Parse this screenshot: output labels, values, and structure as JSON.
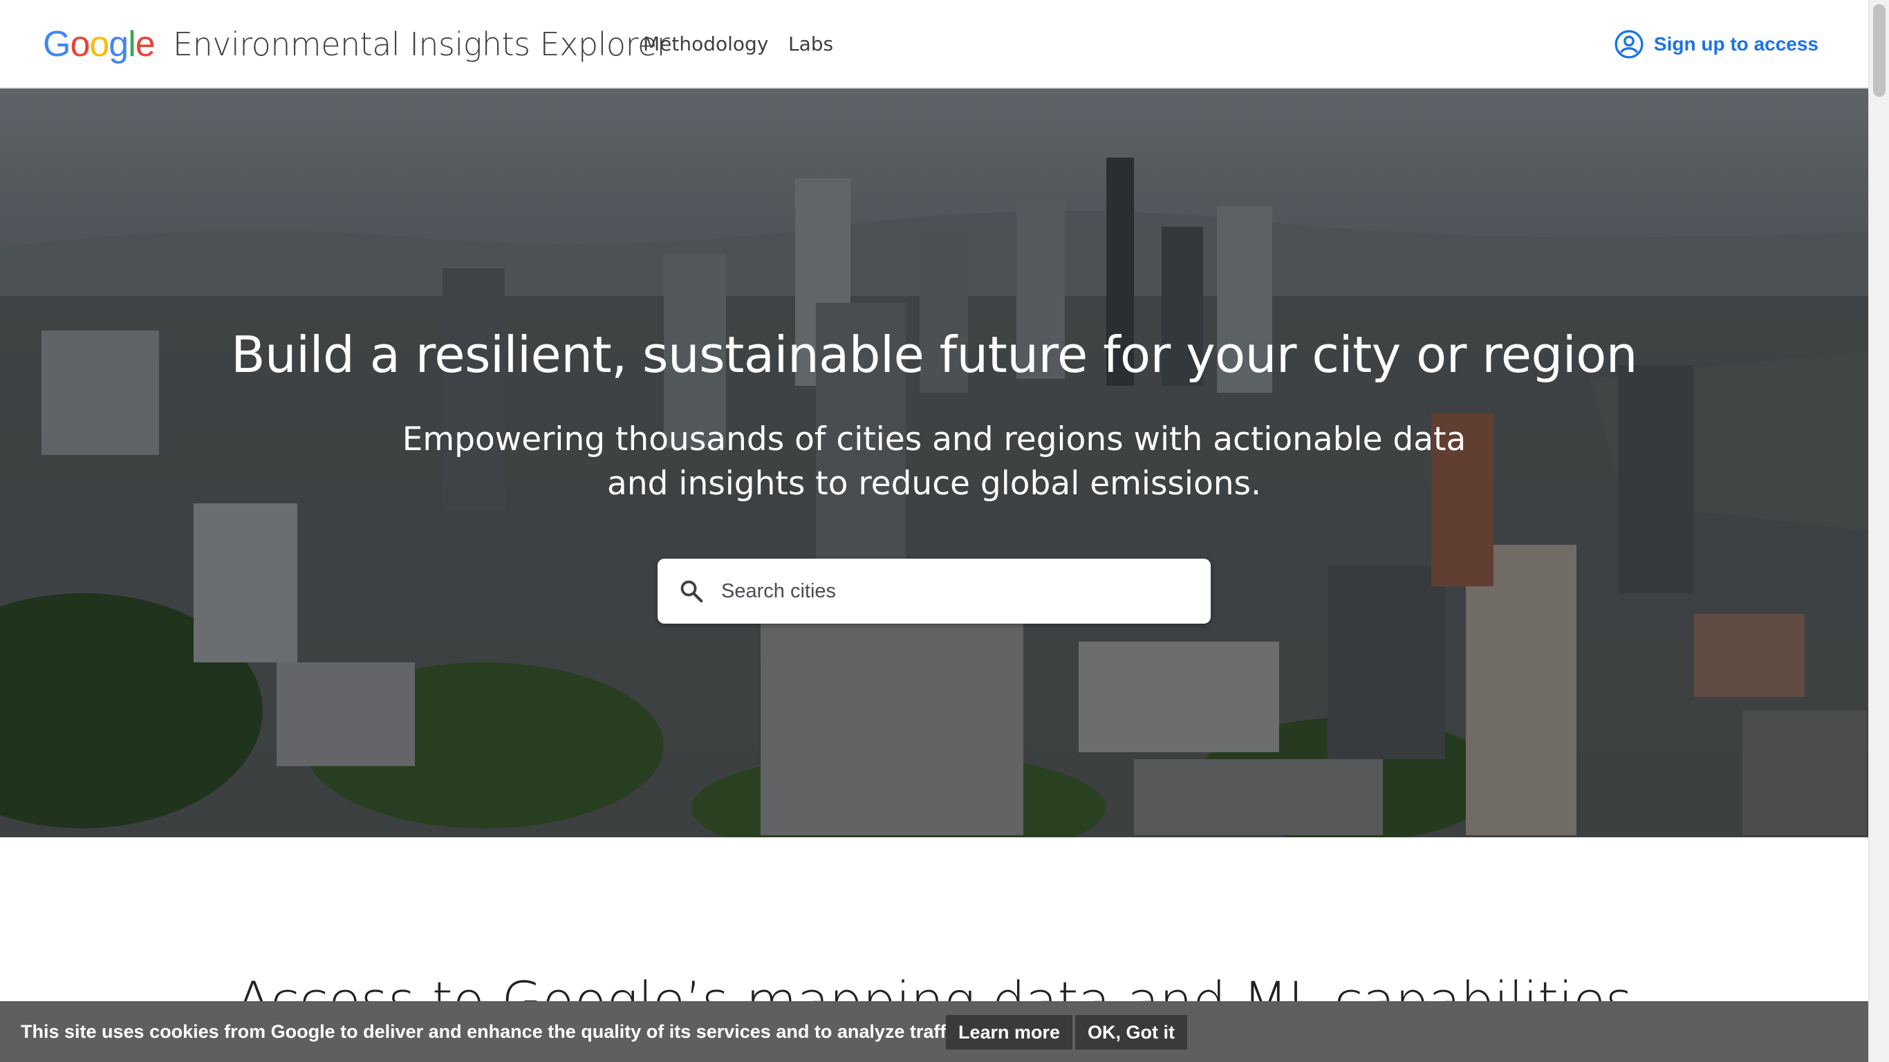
{
  "header": {
    "logo_letters": [
      {
        "char": "G",
        "color": "#4285F4"
      },
      {
        "char": "o",
        "color": "#EA4335"
      },
      {
        "char": "o",
        "color": "#FBBC05"
      },
      {
        "char": "g",
        "color": "#4285F4"
      },
      {
        "char": "l",
        "color": "#34A853"
      },
      {
        "char": "e",
        "color": "#EA4335"
      }
    ],
    "app_title": "Environmental Insights Explorer",
    "nav": [
      {
        "label": "Methodology"
      },
      {
        "label": "Labs"
      }
    ],
    "signup_label": "Sign up to access",
    "signup_icon": "account-circle-icon",
    "accent_color": "#1a73e8"
  },
  "hero": {
    "title": "Build a resilient, sustainable future for your city or region",
    "subtitle_line1": "Empowering thousands of cities and regions with actionable data",
    "subtitle_line2": "and insights to reduce global emissions.",
    "search": {
      "placeholder": "Search cities",
      "icon": "search-icon"
    }
  },
  "section": {
    "heading": "Access to Google’s mapping data and ML capabilities"
  },
  "cookie_bar": {
    "text": "This site uses cookies from Google to deliver and enhance the quality of its services and to analyze traffic.",
    "learn_more": "Learn more",
    "ok": "OK, Got it"
  }
}
